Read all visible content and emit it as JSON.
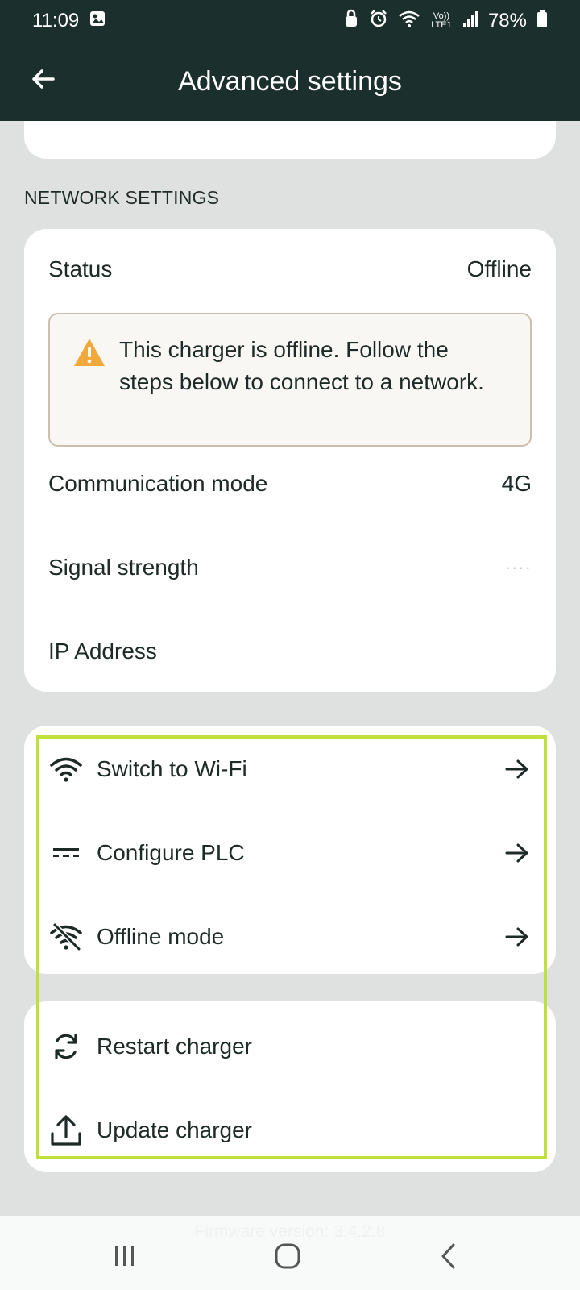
{
  "status_bar": {
    "time": "11:09",
    "network_label": "Vo)) LTE1",
    "battery": "78%"
  },
  "app_bar": {
    "title": "Advanced settings",
    "back_icon": "arrow-left-icon"
  },
  "network_settings": {
    "section_title": "NETWORK SETTINGS",
    "status": {
      "label": "Status",
      "value": "Offline"
    },
    "warning": {
      "icon": "warning-triangle-icon",
      "text": "This charger is offline. Follow the steps below to connect to a network."
    },
    "communication_mode": {
      "label": "Communication mode",
      "value": "4G"
    },
    "signal_strength": {
      "label": "Signal strength",
      "value": "····"
    },
    "ip_address": {
      "label": "IP Address",
      "value": ""
    }
  },
  "actions": [
    {
      "label": "Switch to Wi-Fi",
      "icon": "wifi-icon",
      "arrow": "arrow-right-icon"
    },
    {
      "label": "Configure PLC",
      "icon": "plc-icon",
      "arrow": "arrow-right-icon"
    },
    {
      "label": "Offline mode",
      "icon": "wifi-off-icon",
      "arrow": "arrow-right-icon"
    }
  ],
  "charger_actions": [
    {
      "label": "Restart charger",
      "icon": "restart-icon"
    },
    {
      "label": "Update charger",
      "icon": "upload-icon"
    }
  ],
  "footer": {
    "firmware": "Firmware version: 3.4.2.8"
  },
  "colors": {
    "header_bg": "#1b302c",
    "page_bg": "#dfe1e1",
    "highlight": "#bfe03a",
    "warning_icon": "#f2a93b"
  }
}
